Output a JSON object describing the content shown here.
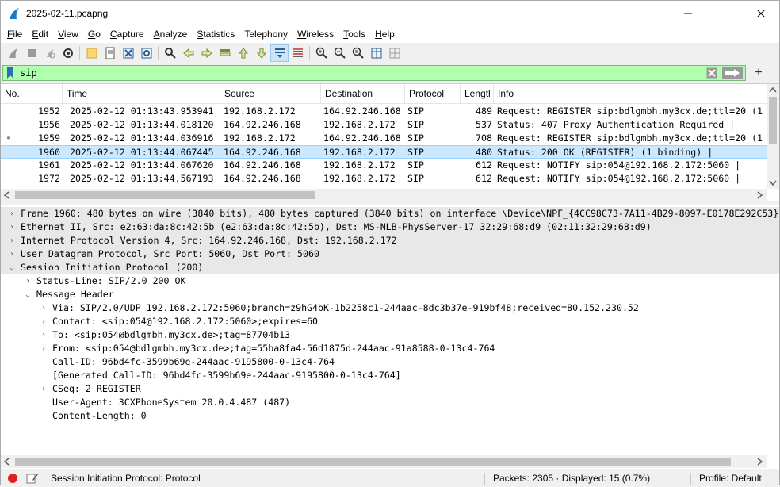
{
  "window": {
    "title": "2025-02-11.pcapng"
  },
  "menu": [
    {
      "label": "File",
      "u": "F",
      "rest": "ile"
    },
    {
      "label": "Edit",
      "u": "E",
      "rest": "dit"
    },
    {
      "label": "View",
      "u": "V",
      "rest": "iew"
    },
    {
      "label": "Go",
      "u": "G",
      "rest": "o"
    },
    {
      "label": "Capture",
      "u": "C",
      "rest": "apture"
    },
    {
      "label": "Analyze",
      "u": "A",
      "rest": "nalyze"
    },
    {
      "label": "Statistics",
      "u": "S",
      "rest": "tatistics"
    },
    {
      "label": "Telephony",
      "u": "",
      "rest": "Telephony"
    },
    {
      "label": "Wireless",
      "u": "W",
      "rest": "ireless"
    },
    {
      "label": "Tools",
      "u": "T",
      "rest": "ools"
    },
    {
      "label": "Help",
      "u": "H",
      "rest": "elp"
    }
  ],
  "filter": {
    "value": "sip"
  },
  "packet_list": {
    "columns": [
      "No.",
      "Time",
      "Source",
      "Destination",
      "Protocol",
      "Length",
      "Info"
    ],
    "columns_shown": [
      "No.",
      "Time",
      "Source",
      "Destination",
      "Protocol",
      "Lengtl",
      "Info"
    ],
    "rows": [
      {
        "no": "1952",
        "time": "2025-02-12 01:13:43.953941",
        "src": "192.168.2.172",
        "dst": "164.92.246.168",
        "proto": "SIP",
        "len": "489",
        "info": "Request: REGISTER sip:bdlgmbh.my3cx.de;ttl=20  (1",
        "marker": ""
      },
      {
        "no": "1956",
        "time": "2025-02-12 01:13:44.018120",
        "src": "164.92.246.168",
        "dst": "192.168.2.172",
        "proto": "SIP",
        "len": "537",
        "info": "Status: 407 Proxy Authentication Required |",
        "marker": ""
      },
      {
        "no": "1959",
        "time": "2025-02-12 01:13:44.036916",
        "src": "192.168.2.172",
        "dst": "164.92.246.168",
        "proto": "SIP",
        "len": "708",
        "info": "Request: REGISTER sip:bdlgmbh.my3cx.de;ttl=20  (1",
        "marker": "•"
      },
      {
        "no": "1960",
        "time": "2025-02-12 01:13:44.067445",
        "src": "164.92.246.168",
        "dst": "192.168.2.172",
        "proto": "SIP",
        "len": "480",
        "info": "Status: 200 OK (REGISTER)  (1 binding) |",
        "marker": ""
      },
      {
        "no": "1961",
        "time": "2025-02-12 01:13:44.067620",
        "src": "164.92.246.168",
        "dst": "192.168.2.172",
        "proto": "SIP",
        "len": "612",
        "info": "Request: NOTIFY sip:054@192.168.2.172:5060 |",
        "marker": ""
      },
      {
        "no": "1972",
        "time": "2025-02-12 01:13:44.567193",
        "src": "164.92.246.168",
        "dst": "192.168.2.172",
        "proto": "SIP",
        "len": "612",
        "info": "Request: NOTIFY sip:054@192.168.2.172:5060 |",
        "marker": ""
      }
    ]
  },
  "details": [
    {
      "arrow": "›",
      "text": "Frame 1960: 480 bytes on wire (3840 bits), 480 bytes captured (3840 bits) on interface \\Device\\NPF_{4CC98C73-7A11-4B29-8097-E0178E292C53}"
    },
    {
      "arrow": "›",
      "text": "Ethernet II, Src: e2:63:da:8c:42:5b (e2:63:da:8c:42:5b), Dst: MS-NLB-PhysServer-17_32:29:68:d9 (02:11:32:29:68:d9)"
    },
    {
      "arrow": "›",
      "text": "Internet Protocol Version 4, Src: 164.92.246.168, Dst: 192.168.2.172"
    },
    {
      "arrow": "›",
      "text": "User Datagram Protocol, Src Port: 5060, Dst Port: 5060"
    },
    {
      "arrow": "⌄",
      "text": "Session Initiation Protocol (200)"
    },
    {
      "arrow": "›",
      "text": "Status-Line: SIP/2.0 200 OK"
    },
    {
      "arrow": "⌄",
      "text": "Message Header"
    },
    {
      "arrow": "›",
      "text": "Via: SIP/2.0/UDP 192.168.2.172:5060;branch=z9hG4bK-1b2258c1-244aac-8dc3b37e-919bf48;received=80.152.230.52"
    },
    {
      "arrow": "›",
      "text": "Contact: <sip:054@192.168.2.172:5060>;expires=60"
    },
    {
      "arrow": "›",
      "text": "To: <sip:054@bdlgmbh.my3cx.de>;tag=87704b13"
    },
    {
      "arrow": "›",
      "text": "From: <sip:054@bdlgmbh.my3cx.de>;tag=55ba8fa4-56d1875d-244aac-91a8588-0-13c4-764"
    },
    {
      "arrow": "",
      "text": "Call-ID: 96bd4fc-3599b69e-244aac-9195800-0-13c4-764"
    },
    {
      "arrow": "",
      "text": "[Generated Call-ID: 96bd4fc-3599b69e-244aac-9195800-0-13c4-764]"
    },
    {
      "arrow": "›",
      "text": "CSeq: 2 REGISTER"
    },
    {
      "arrow": "",
      "text": "User-Agent: 3CXPhoneSystem 20.0.4.487 (487)"
    },
    {
      "arrow": "",
      "text": "Content-Length: 0"
    }
  ],
  "status": {
    "protocol": "Session Initiation Protocol: Protocol",
    "packets": "Packets: 2305 · Displayed: 15 (0.7%)",
    "profile": "Profile: Default"
  }
}
